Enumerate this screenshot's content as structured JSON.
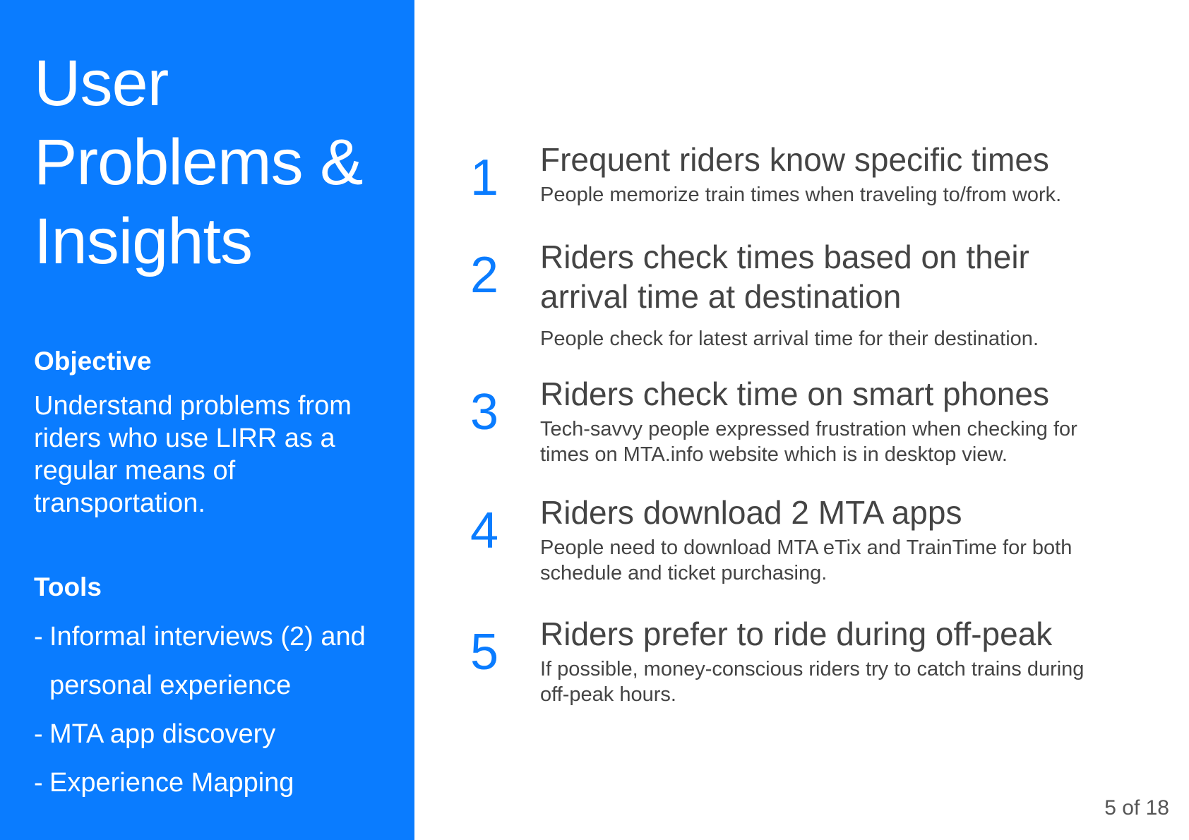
{
  "sidebar": {
    "title_lines": [
      "User",
      "Problems &",
      "Insights"
    ],
    "objective_heading": "Objective",
    "objective_text": "Understand problems from riders who use LIRR as a regular means of transportation.",
    "tools_heading": "Tools",
    "tools": [
      "Informal interviews (2) and personal experience",
      "MTA app discovery",
      "Experience Mapping"
    ],
    "background_color": "#0a7cff"
  },
  "insights": [
    {
      "number": "1",
      "title": "Frequent riders know specific times",
      "description": "People memorize train times when traveling to/from work."
    },
    {
      "number": "2",
      "title": "Riders check times based on their arrival time at destination",
      "description": "People check for latest arrival time for their destination."
    },
    {
      "number": "3",
      "title": "Riders check time on smart phones",
      "description": "Tech-savvy people expressed frustration when checking for times on MTA.info website which is in desktop view."
    },
    {
      "number": "4",
      "title": "Riders download 2 MTA apps",
      "description": "People need to download MTA eTix and TrainTime for both schedule and ticket purchasing."
    },
    {
      "number": "5",
      "title": "Riders prefer to ride during off-peak",
      "description": "If possible, money-conscious riders try to catch trains during off-peak hours."
    }
  ],
  "page_counter": "5 of 18",
  "accent_color": "#0a7cff"
}
